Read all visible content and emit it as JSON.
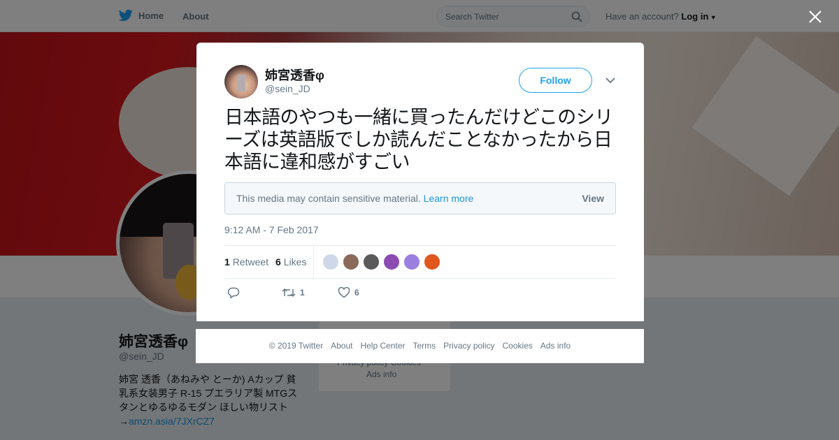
{
  "nav": {
    "home": "Home",
    "about": "About",
    "search_placeholder": "Search Twitter",
    "have_account": "Have an account?",
    "login": "Log in"
  },
  "profile": {
    "name": "姉宮透香φ",
    "handle": "@sein_JD",
    "bio": "姉宮 透香（あねみや とーか) Aカップ 貧乳系女装男子 R-15 プエラリア製 MTGスタンとゆるゆるモダン ほしい物リスト→",
    "bio_link": "amzn.asia/7JXrCZ7",
    "side_line1": "Privacy policy   Cookies",
    "side_line2": "Ads info"
  },
  "tweet": {
    "name": "姉宮透香φ",
    "handle": "@sein_JD",
    "follow_label": "Follow",
    "text": "日本語のやつも一緒に買ったんだけどこのシリーズは英語版でしか読んだことなかったから日本語に違和感がすごい",
    "sensitive_msg": "This media may contain sensitive material.",
    "learn_more": "Learn more",
    "view_label": "View",
    "timestamp": "9:12 AM - 7 Feb 2017",
    "retweet_count": "1",
    "retweet_label": "Retweet",
    "like_count": "6",
    "like_label": "Likes",
    "action_retweets": "1",
    "action_likes": "6",
    "liker_colors": [
      "#cfd8e8",
      "#8a6a5a",
      "#5a5a5a",
      "#8b4bb0",
      "#9a7fe0",
      "#e0561c"
    ]
  },
  "footer": {
    "links": [
      "© 2019 Twitter",
      "About",
      "Help Center",
      "Terms",
      "Privacy policy",
      "Cookies",
      "Ads info"
    ]
  },
  "colors": {
    "brand": "#1da1f2",
    "link": "#1b95e0",
    "muted": "#657786"
  }
}
